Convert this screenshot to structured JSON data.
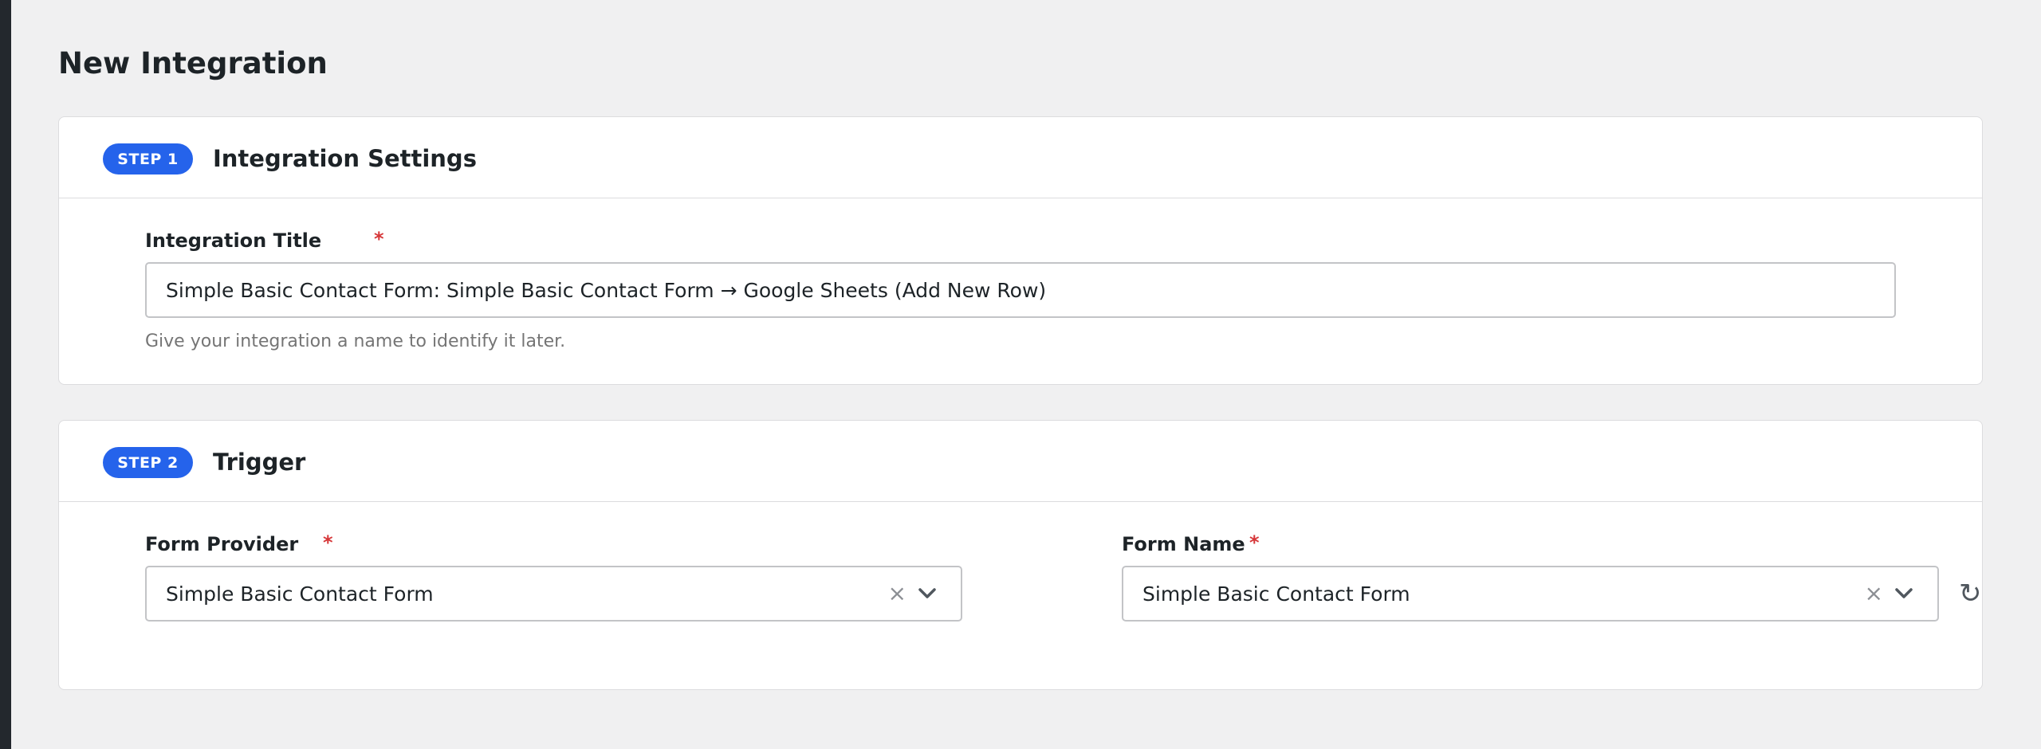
{
  "page": {
    "title": "New Integration"
  },
  "step1": {
    "badge": "STEP 1",
    "title": "Integration Settings",
    "integration_title": {
      "label": "Integration Title",
      "required_mark": "*",
      "value": "Simple Basic Contact Form: Simple Basic Contact Form → Google Sheets (Add New Row)",
      "help": "Give your integration a name to identify it later."
    }
  },
  "step2": {
    "badge": "STEP 2",
    "title": "Trigger",
    "form_provider": {
      "label": "Form Provider",
      "required_mark": "*",
      "value": "Simple Basic Contact Form"
    },
    "form_name": {
      "label": "Form Name",
      "required_mark": "*",
      "value": "Simple Basic Contact Form"
    }
  },
  "icons": {
    "clear": "close-icon",
    "dropdown": "chevron-down-icon",
    "refresh": "refresh-icon"
  },
  "colors": {
    "accent": "#2563eb",
    "required": "#d63638",
    "background": "#f0f0f1"
  }
}
